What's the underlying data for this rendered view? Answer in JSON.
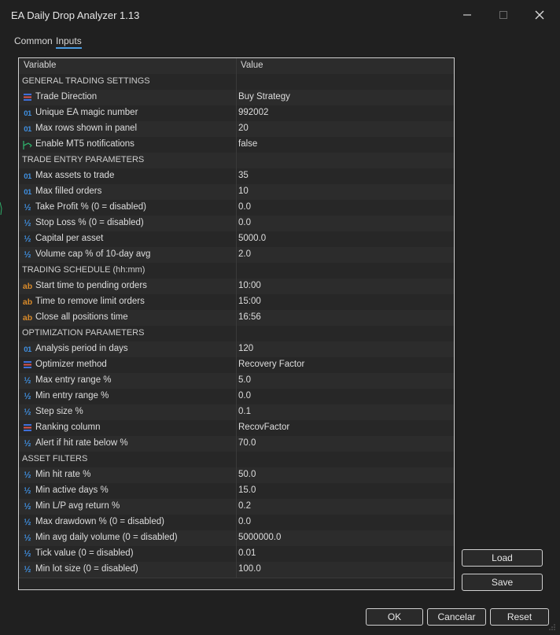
{
  "window": {
    "title": "EA Daily Drop Analyzer 1.13"
  },
  "tabs": [
    {
      "label": "Common"
    },
    {
      "label": "Inputs"
    }
  ],
  "table": {
    "headers": {
      "variable": "Variable",
      "value": "Value"
    },
    "rows": [
      {
        "kind": "section",
        "label": "GENERAL TRADING SETTINGS"
      },
      {
        "kind": "param",
        "icon": "enum",
        "label": "Trade Direction",
        "value": "Buy Strategy"
      },
      {
        "kind": "param",
        "icon": "int",
        "label": "Unique EA magic number",
        "value": "992002"
      },
      {
        "kind": "param",
        "icon": "int",
        "label": "Max rows shown in panel",
        "value": "20"
      },
      {
        "kind": "param",
        "icon": "bool",
        "label": "Enable MT5 notifications",
        "value": "false"
      },
      {
        "kind": "section",
        "label": "TRADE ENTRY PARAMETERS"
      },
      {
        "kind": "param",
        "icon": "int",
        "label": "Max assets to trade",
        "value": "35"
      },
      {
        "kind": "param",
        "icon": "int",
        "label": "Max filled orders",
        "value": "10"
      },
      {
        "kind": "param",
        "icon": "double",
        "label": "Take Profit % (0 = disabled)",
        "value": "0.0"
      },
      {
        "kind": "param",
        "icon": "double",
        "label": "Stop Loss % (0 = disabled)",
        "value": "0.0"
      },
      {
        "kind": "param",
        "icon": "double",
        "label": "Capital per asset",
        "value": "5000.0"
      },
      {
        "kind": "param",
        "icon": "double",
        "label": "Volume cap % of 10-day avg",
        "value": "2.0"
      },
      {
        "kind": "section",
        "label": "TRADING SCHEDULE (hh:mm)"
      },
      {
        "kind": "param",
        "icon": "string",
        "label": "Start time to pending orders",
        "value": "10:00"
      },
      {
        "kind": "param",
        "icon": "string",
        "label": "Time to remove limit orders",
        "value": "15:00"
      },
      {
        "kind": "param",
        "icon": "string",
        "label": "Close all positions time",
        "value": "16:56"
      },
      {
        "kind": "section",
        "label": "OPTIMIZATION PARAMETERS"
      },
      {
        "kind": "param",
        "icon": "int",
        "label": "Analysis period in days",
        "value": "120"
      },
      {
        "kind": "param",
        "icon": "enum",
        "label": "Optimizer method",
        "value": "Recovery Factor"
      },
      {
        "kind": "param",
        "icon": "double",
        "label": "Max entry range %",
        "value": "5.0"
      },
      {
        "kind": "param",
        "icon": "double",
        "label": "Min entry range %",
        "value": "0.0"
      },
      {
        "kind": "param",
        "icon": "double",
        "label": "Step size %",
        "value": "0.1"
      },
      {
        "kind": "param",
        "icon": "enum",
        "label": "Ranking column",
        "value": "RecovFactor"
      },
      {
        "kind": "param",
        "icon": "double",
        "label": "Alert if hit rate below %",
        "value": "70.0"
      },
      {
        "kind": "section",
        "label": "ASSET FILTERS"
      },
      {
        "kind": "param",
        "icon": "double",
        "label": "Min hit rate %",
        "value": "50.0"
      },
      {
        "kind": "param",
        "icon": "double",
        "label": "Min active days %",
        "value": "15.0"
      },
      {
        "kind": "param",
        "icon": "double",
        "label": "Min L/P avg return %",
        "value": "0.2"
      },
      {
        "kind": "param",
        "icon": "double",
        "label": "Max drawdown % (0 = disabled)",
        "value": "0.0"
      },
      {
        "kind": "param",
        "icon": "double",
        "label": "Min avg daily volume (0 = disabled)",
        "value": "5000000.0"
      },
      {
        "kind": "param",
        "icon": "double",
        "label": "Tick value (0 = disabled)",
        "value": "0.01"
      },
      {
        "kind": "param",
        "icon": "double",
        "label": "Min lot size (0 = disabled)",
        "value": "100.0"
      }
    ]
  },
  "side_buttons": {
    "load": "Load",
    "save": "Save"
  },
  "footer_buttons": {
    "ok": "OK",
    "cancel": "Cancelar",
    "reset": "Reset"
  },
  "icons": {
    "minimize": "minimize-icon",
    "maximize": "maximize-icon",
    "close": "close-icon",
    "enum": "enum-list-icon",
    "int": "integer-icon",
    "double": "fraction-icon",
    "string": "string-ab-icon",
    "bool": "bool-arrow-icon"
  },
  "colors": {
    "accent": "#4a9be0",
    "int_icon": "#3f8fe0",
    "string_icon": "#d88a2a",
    "bool_icon": "#2fae6a",
    "enum_red": "#d9534f",
    "enum_blue": "#3f6fd9"
  }
}
